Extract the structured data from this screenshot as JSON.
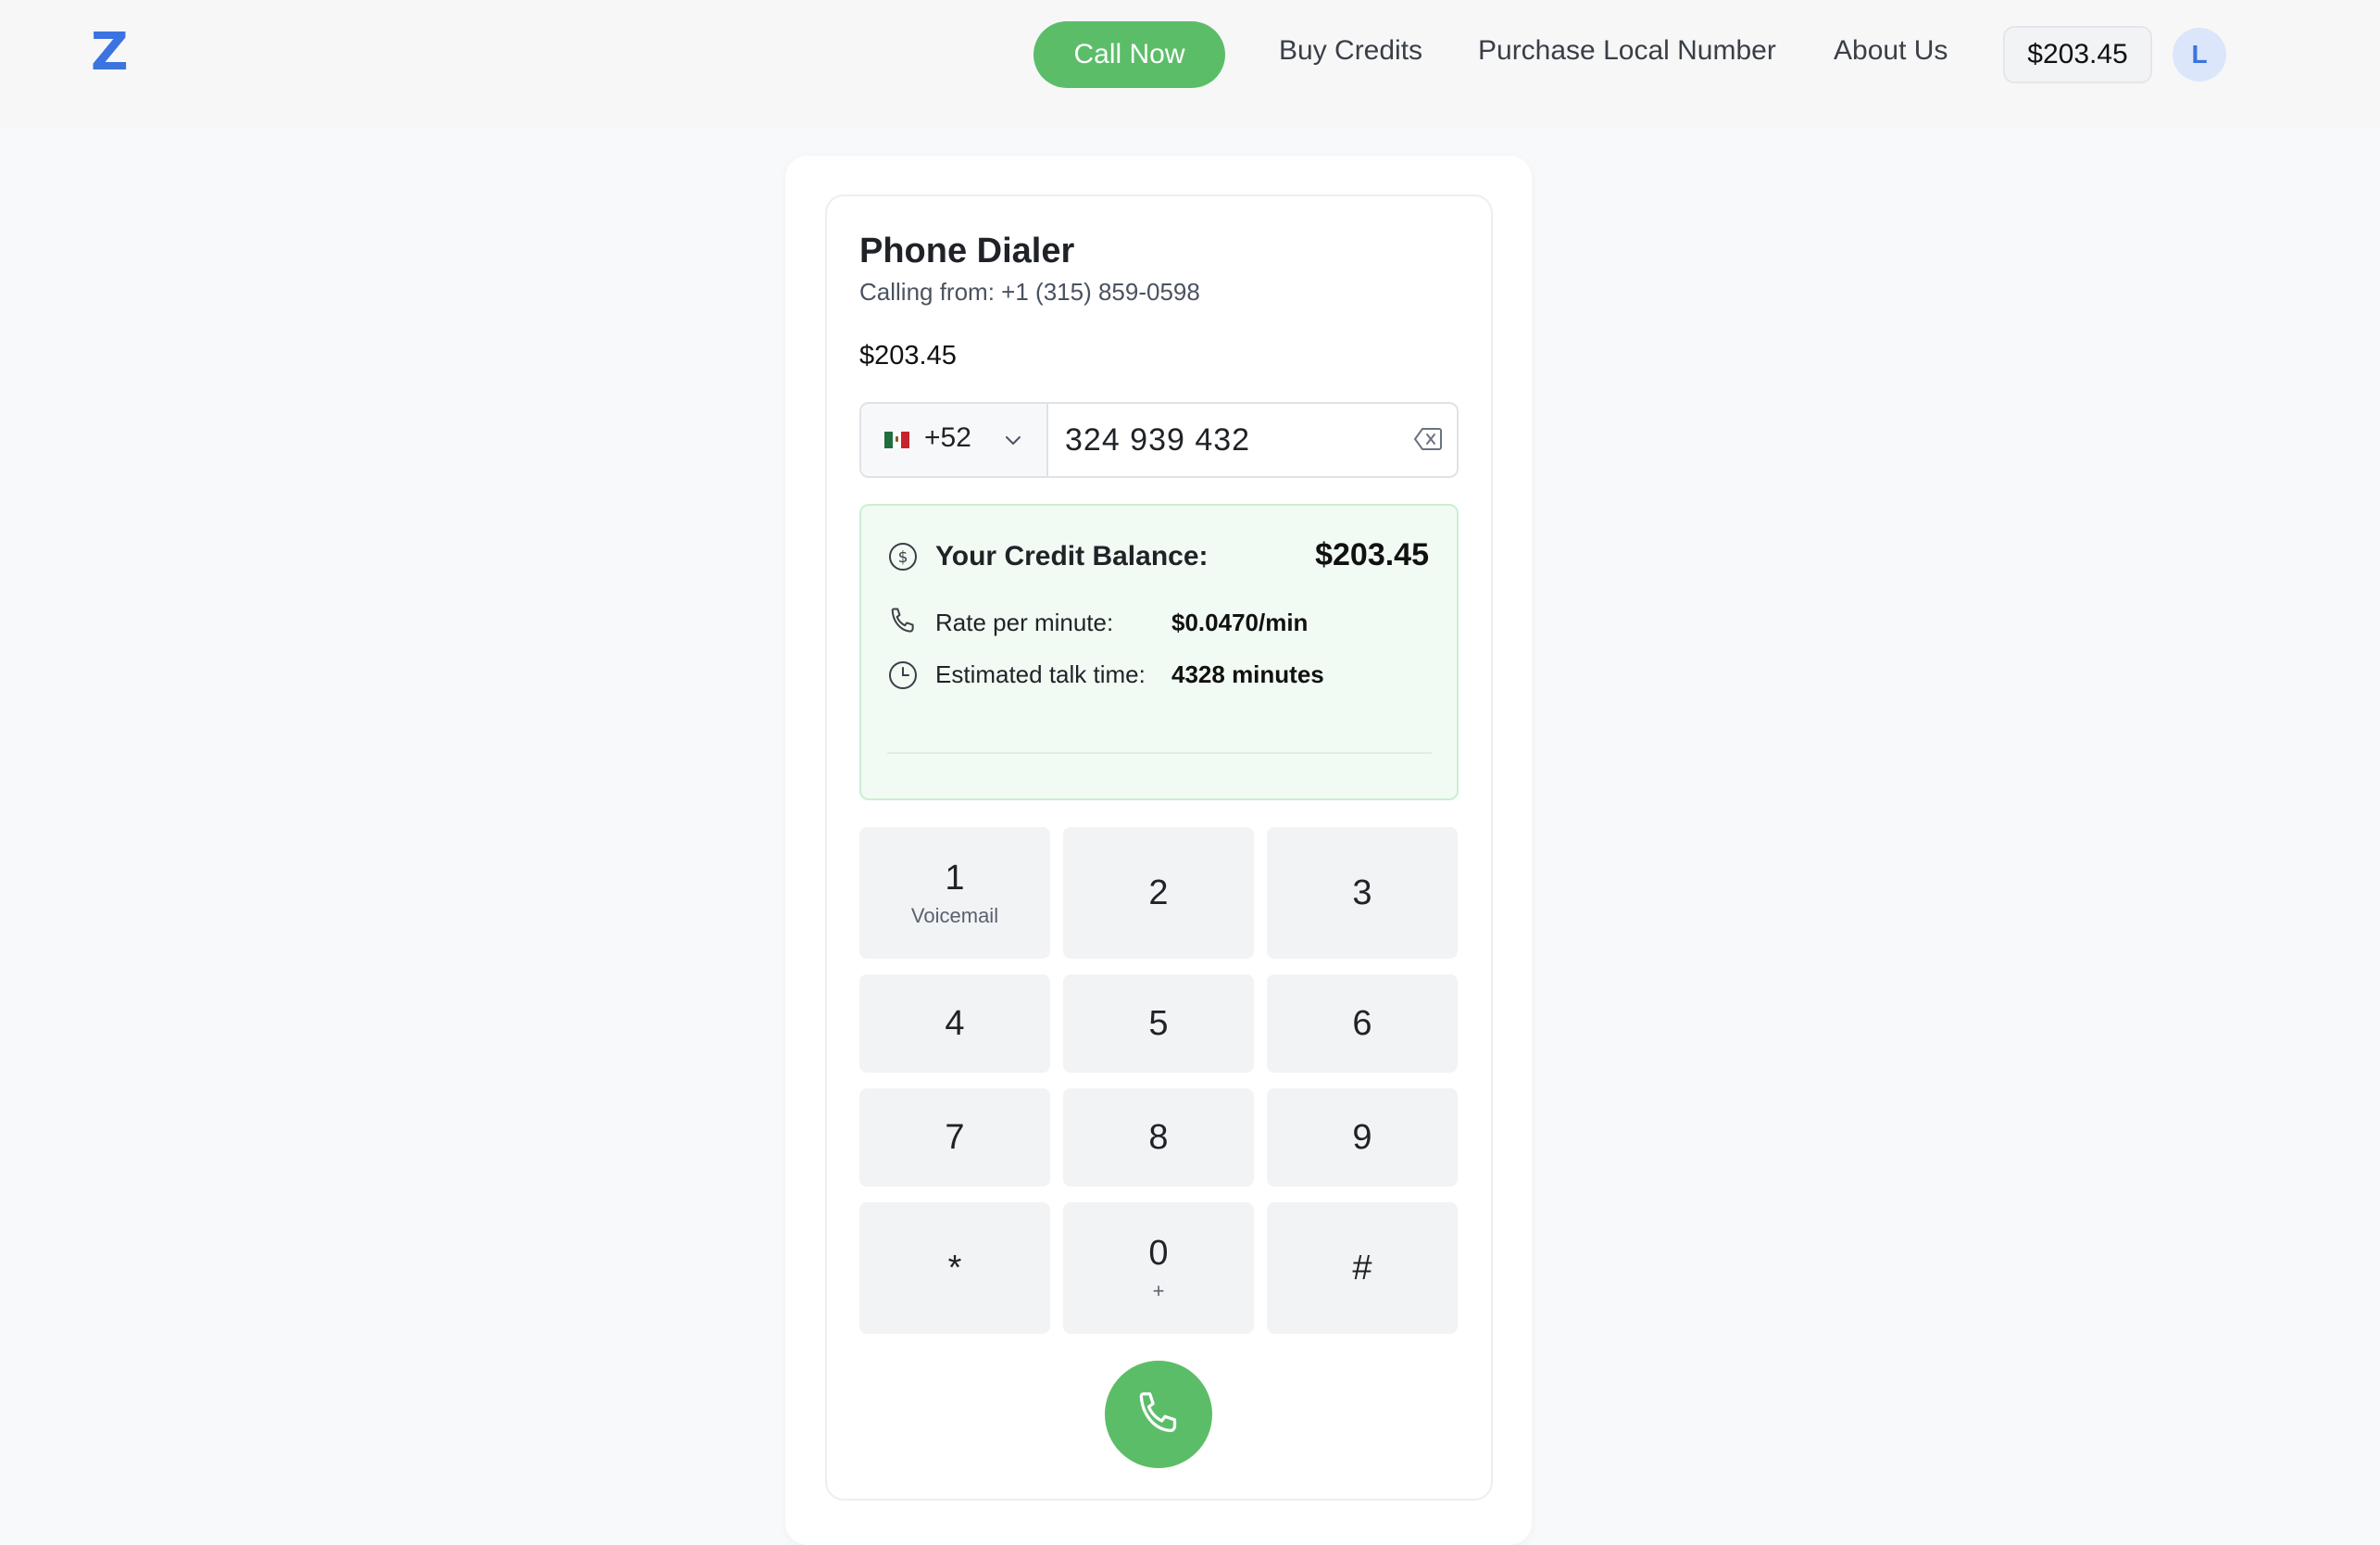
{
  "header": {
    "logo": "Z",
    "call_now": "Call Now",
    "nav": [
      "Buy Credits",
      "Purchase Local Number",
      "About Us"
    ],
    "balance": "$203.45",
    "avatar_initial": "L"
  },
  "dialer": {
    "title": "Phone Dialer",
    "calling_from_label": "Calling from:",
    "calling_from_number": "+1 (315) 859-0598",
    "balance": "$203.45",
    "country_flag": "mexico-flag",
    "country_code": "+52",
    "phone_value": "324 939 432"
  },
  "credit": {
    "title": "Your Credit Balance:",
    "amount": "$203.45",
    "rate_label": "Rate per minute:",
    "rate_value": "$0.0470/min",
    "talk_label": "Estimated talk time:",
    "talk_value": "4328 minutes",
    "accent_color": "#5cbd69"
  },
  "keypad": [
    {
      "digit": "1",
      "sub": "Voicemail"
    },
    {
      "digit": "2",
      "sub": ""
    },
    {
      "digit": "3",
      "sub": ""
    },
    {
      "digit": "4",
      "sub": ""
    },
    {
      "digit": "5",
      "sub": ""
    },
    {
      "digit": "6",
      "sub": ""
    },
    {
      "digit": "7",
      "sub": ""
    },
    {
      "digit": "8",
      "sub": ""
    },
    {
      "digit": "9",
      "sub": ""
    },
    {
      "digit": "*",
      "sub": ""
    },
    {
      "digit": "0",
      "sub": "+"
    },
    {
      "digit": "#",
      "sub": ""
    }
  ],
  "call_button_icon": "phone-icon"
}
